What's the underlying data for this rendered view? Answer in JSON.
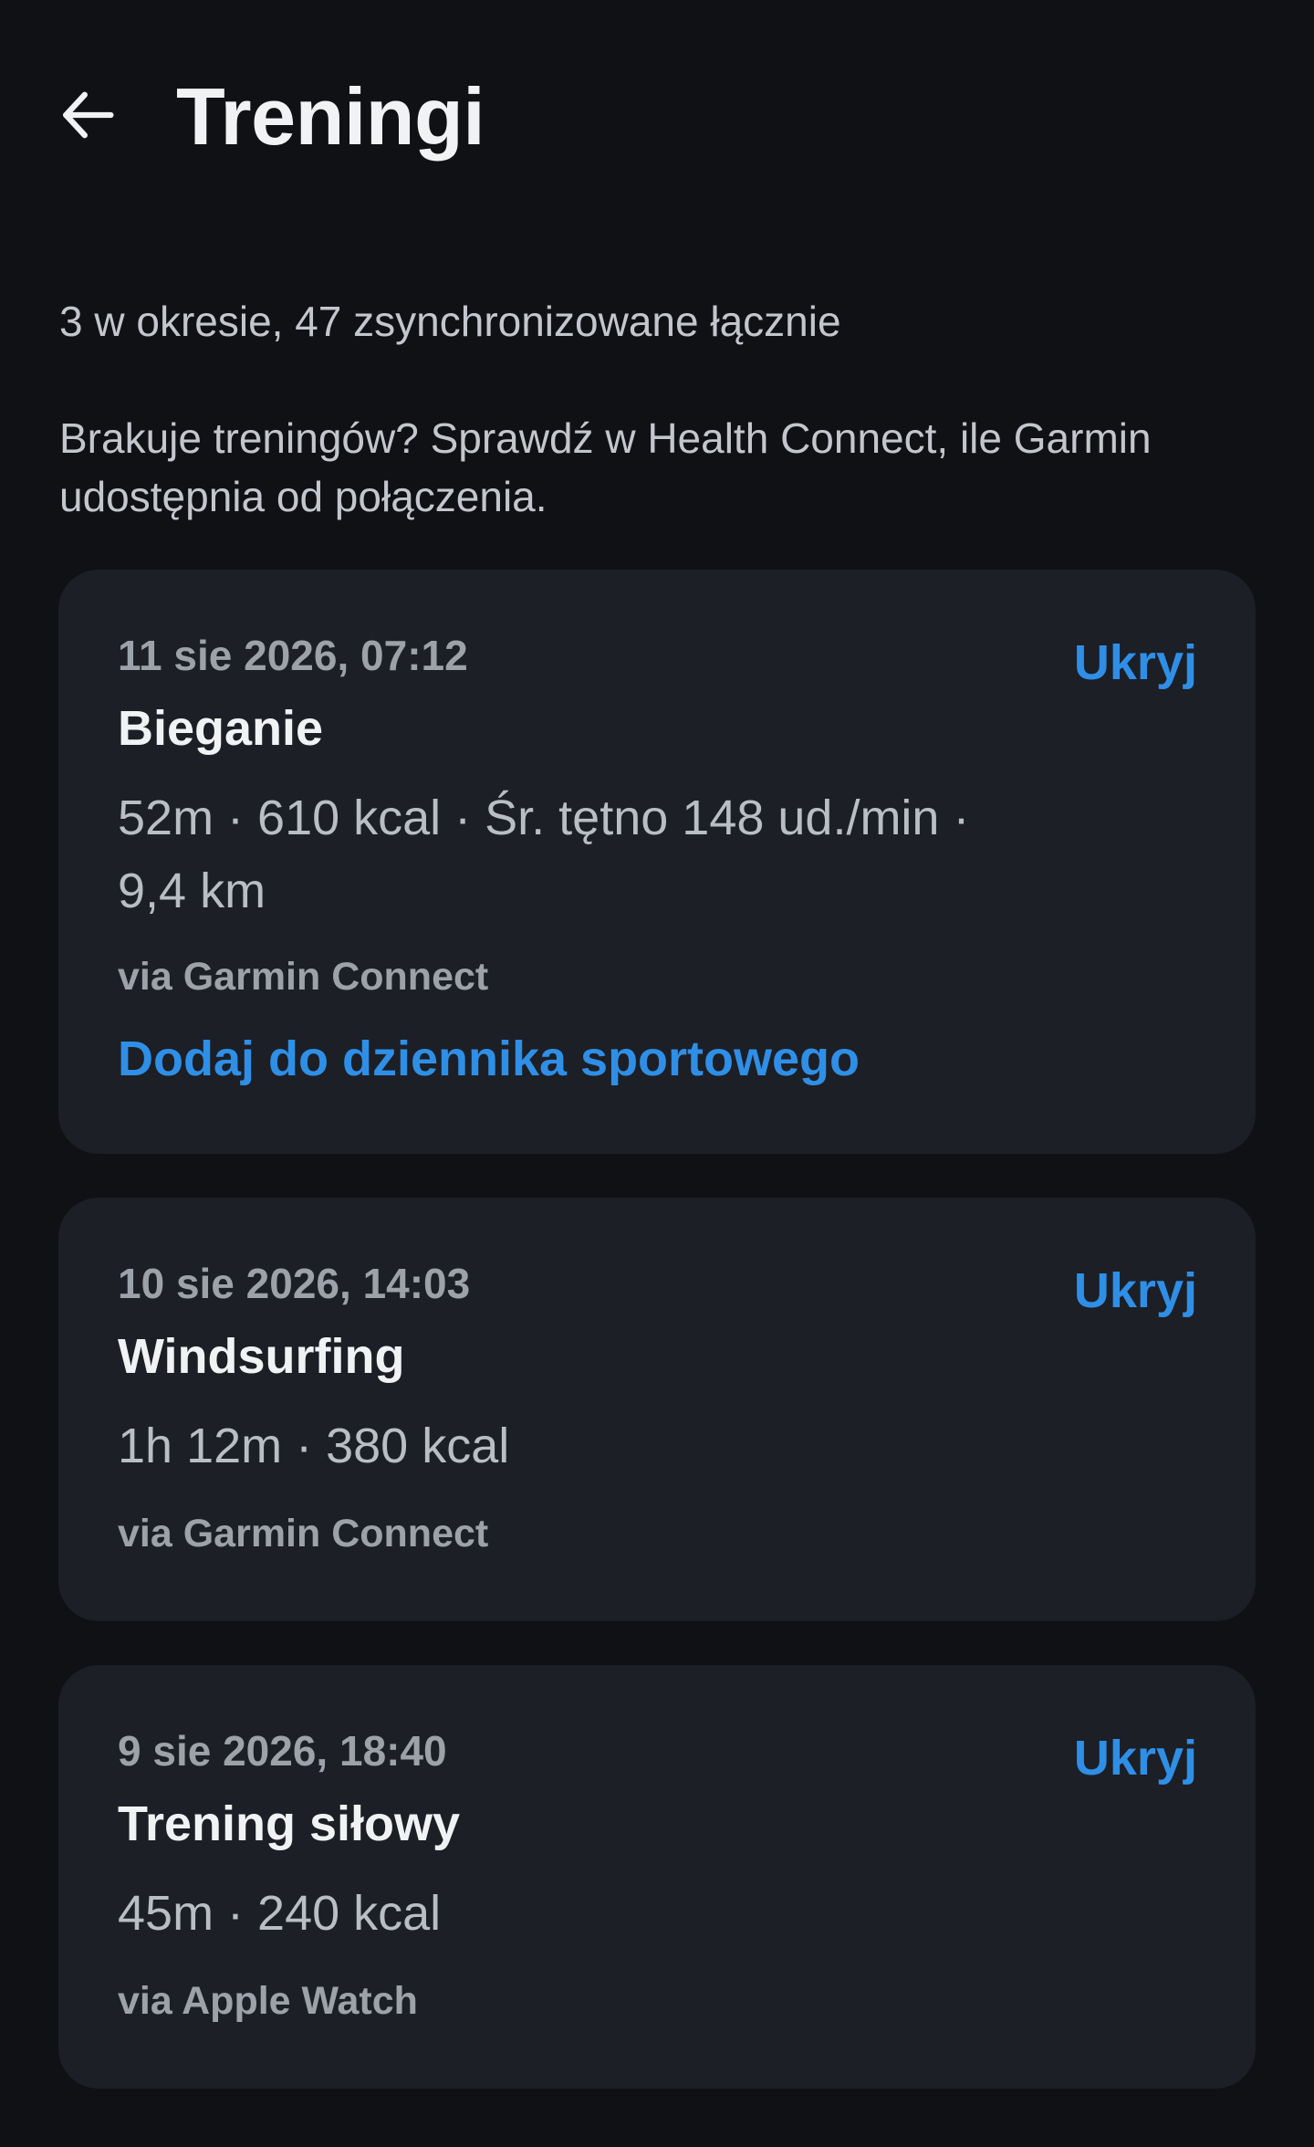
{
  "header": {
    "back_icon": "arrow-left-icon",
    "title": "Treningi"
  },
  "summary": "3 w okresie, 47 zsynchronizowane łącznie",
  "hint": "Brakuje treningów? Sprawdź w Health Connect, ile Garmin udostępnia od połączenia.",
  "colors": {
    "background": "#101115",
    "card": "#1c1f26",
    "accent": "#2f8fe6"
  },
  "workouts": [
    {
      "date": "11 sie 2026, 07:12",
      "name": "Bieganie",
      "stats": "52m · 610 kcal · Śr. tętno 148 ud./min · 9,4 km",
      "source": "via Garmin Connect",
      "hide_label": "Ukryj",
      "add_label": "Dodaj do dziennika sportowego"
    },
    {
      "date": "10 sie 2026, 14:03",
      "name": "Windsurfing",
      "stats": "1h 12m · 380 kcal",
      "source": "via Garmin Connect",
      "hide_label": "Ukryj"
    },
    {
      "date": "9 sie 2026, 18:40",
      "name": "Trening siłowy",
      "stats": "45m · 240 kcal",
      "source": "via Apple Watch",
      "hide_label": "Ukryj"
    }
  ]
}
